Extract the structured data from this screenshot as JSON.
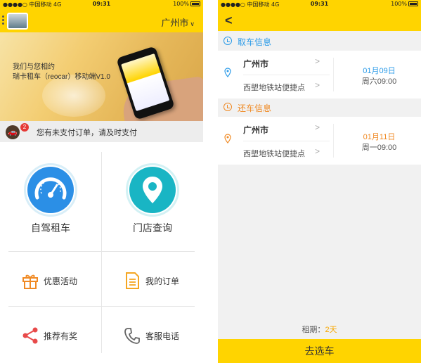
{
  "status_bar": {
    "carrier": "中国移动",
    "network": "4G",
    "time": "09:31",
    "battery": "100%"
  },
  "home": {
    "city": "广州市",
    "banner": {
      "line1": "我们与您相约",
      "line2": "瑞卡租车（reocar）移动端V1.0"
    },
    "notice": {
      "badge": "2",
      "text": "您有未支付订单，请及时支付"
    },
    "tiles": [
      {
        "label": "自驾租车",
        "icon": "speedometer-icon",
        "color": "#2b8fe6"
      },
      {
        "label": "门店查询",
        "icon": "location-pin-icon",
        "color": "#19b5c4"
      }
    ],
    "menu": [
      {
        "label": "优惠活动",
        "icon": "gift-icon",
        "color": "#f08a24"
      },
      {
        "label": "我的订单",
        "icon": "order-document-icon",
        "color": "#f5a623"
      },
      {
        "label": "推荐有奖",
        "icon": "share-icon",
        "color": "#e84a4a"
      },
      {
        "label": "客服电话",
        "icon": "phone-icon",
        "color": "#666666"
      }
    ]
  },
  "booking": {
    "pickup": {
      "section_title": "取车信息",
      "city": "广州市",
      "station": "西塱地铁站便捷点",
      "date": "01月09日",
      "time": "周六09:00",
      "color": "#2b9be8"
    },
    "return": {
      "section_title": "还车信息",
      "city": "广州市",
      "station": "西塱地铁站便捷点",
      "date": "01月11日",
      "time": "周一09:00",
      "color": "#f08a24"
    },
    "rent_label": "租期：",
    "rent_value": "2天",
    "submit_label": "去选车"
  }
}
